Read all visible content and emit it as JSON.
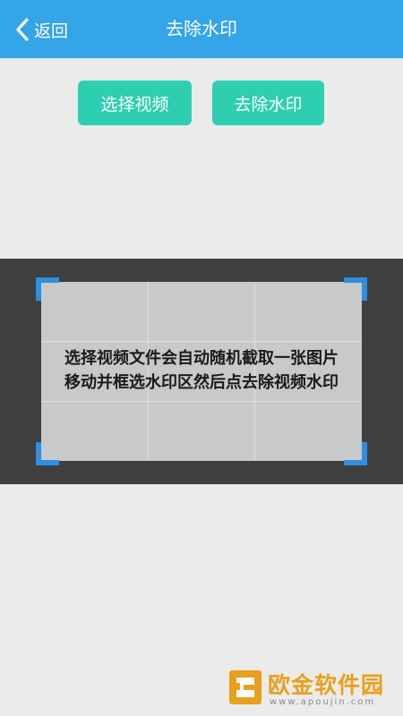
{
  "header": {
    "back_label": "返回",
    "title": "去除水印"
  },
  "actions": {
    "select_video": "选择视频",
    "remove_watermark": "去除水印"
  },
  "preview": {
    "instruction_line1": "选择视频文件会自动随机截取一张图片",
    "instruction_line2": "移动并框选水印区然后点去除视频水印"
  },
  "site_watermark": {
    "name": "欧金软件园",
    "url": "www.apoujin.com"
  },
  "colors": {
    "header_bg": "#34a5e6",
    "button_bg": "#2ecfb0",
    "corner_handles": "#2d8fe0",
    "panel_bg": "#3f3f3f"
  },
  "icons": {
    "back": "chevron-left-icon",
    "watermark_logo": "site-logo-icon"
  }
}
